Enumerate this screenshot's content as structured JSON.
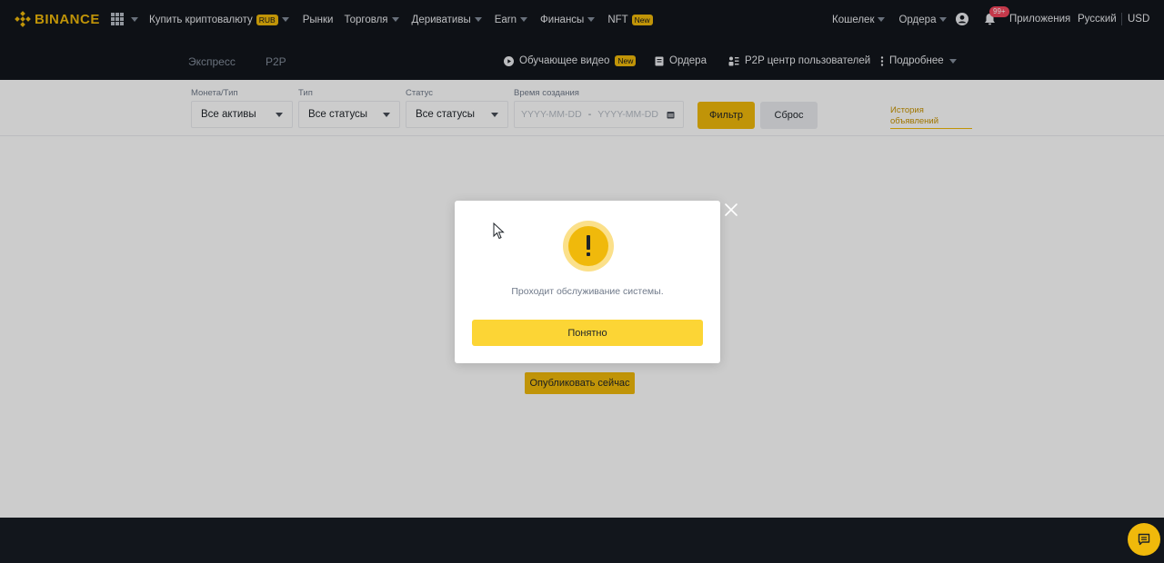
{
  "header": {
    "logo_text": "BINANCE",
    "nav": [
      {
        "label": "Купить криптовалюту",
        "badge": "RUB",
        "caret": true
      },
      {
        "label": "Рынки",
        "badge": "",
        "caret": false
      },
      {
        "label": "Торговля",
        "badge": "",
        "caret": true
      },
      {
        "label": "Деривативы",
        "badge": "",
        "caret": true
      },
      {
        "label": "Earn",
        "badge": "",
        "caret": true
      },
      {
        "label": "Финансы",
        "badge": "",
        "caret": true
      },
      {
        "label": "NFT",
        "badge": "New",
        "caret": false
      }
    ],
    "wallet": "Кошелек",
    "orders": "Ордера",
    "notif_count": "99+",
    "apps": "Приложения",
    "language": "Русский",
    "currency": "USD"
  },
  "subheader": {
    "tabs": [
      "Экспресс",
      "P2P"
    ],
    "video": "Обучающее видео",
    "video_badge": "New",
    "orders": "Ордера",
    "user_center": "P2P центр пользователей",
    "more": "Подробнее"
  },
  "filters": {
    "coin_label": "Монета/Тип",
    "coin_value": "Все активы",
    "type_label": "Тип",
    "type_value": "Все статусы",
    "status_label": "Статус",
    "status_value": "Все статусы",
    "date_label": "Время создания",
    "date_from_placeholder": "YYYY-MM-DD",
    "date_sep": "-",
    "date_to_placeholder": "YYYY-MM-DD",
    "filter_button": "Фильтр",
    "reset_button": "Сброс",
    "history_link": "История объявлений"
  },
  "content": {
    "publish_button": "Опубликовать сейчас"
  },
  "modal": {
    "icon": "warning-icon",
    "message": "Проходит обслуживание системы.",
    "ok_button": "Понятно"
  },
  "colors": {
    "brand": "#F0B90B",
    "header_bg": "#12161C"
  }
}
